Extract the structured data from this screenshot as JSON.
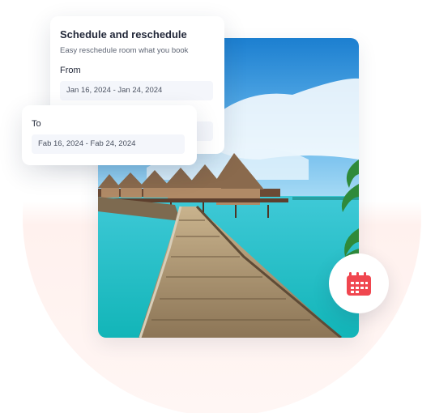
{
  "schedule_card": {
    "title": "Schedule  and reschedule",
    "subtitle": "Easy reschedule room what you book",
    "from_label": "From",
    "from_value": "Jan 16, 2024 - Jan 24, 2024"
  },
  "to_card": {
    "to_label": "To",
    "to_value": "Fab 16, 2024 - Fab 24, 2024"
  },
  "photo": {
    "alt": ""
  },
  "badge": {
    "icon": "calendar-icon",
    "color": "#f0464f"
  }
}
